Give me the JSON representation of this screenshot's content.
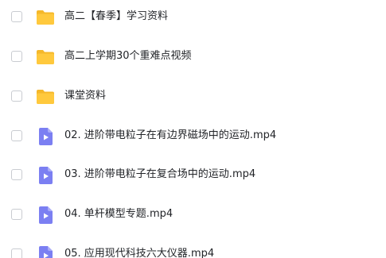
{
  "files": [
    {
      "name": "高二【春季】学习资料",
      "icon": "folder-icon",
      "type": "folder"
    },
    {
      "name": "高二上学期30个重难点视频",
      "icon": "folder-icon",
      "type": "folder"
    },
    {
      "name": "课堂资料",
      "icon": "folder-icon",
      "type": "folder"
    },
    {
      "name": "02. 进阶带电粒子在有边界磁场中的运动.mp4",
      "icon": "video-file-icon",
      "type": "video"
    },
    {
      "name": "03. 进阶带电粒子在复合场中的运动.mp4",
      "icon": "video-file-icon",
      "type": "video"
    },
    {
      "name": "04. 单杆模型专题.mp4",
      "icon": "video-file-icon",
      "type": "video"
    },
    {
      "name": "05. 应用现代科技六大仪器.mp4",
      "icon": "video-file-icon",
      "type": "video"
    }
  ],
  "colors": {
    "folder": "#ffc93d",
    "folder_back": "#f5b82a",
    "video_doc": "#7b7ff2",
    "video_play": "#ffffff",
    "text": "#222428",
    "checkbox_border": "#c9ccd1"
  }
}
